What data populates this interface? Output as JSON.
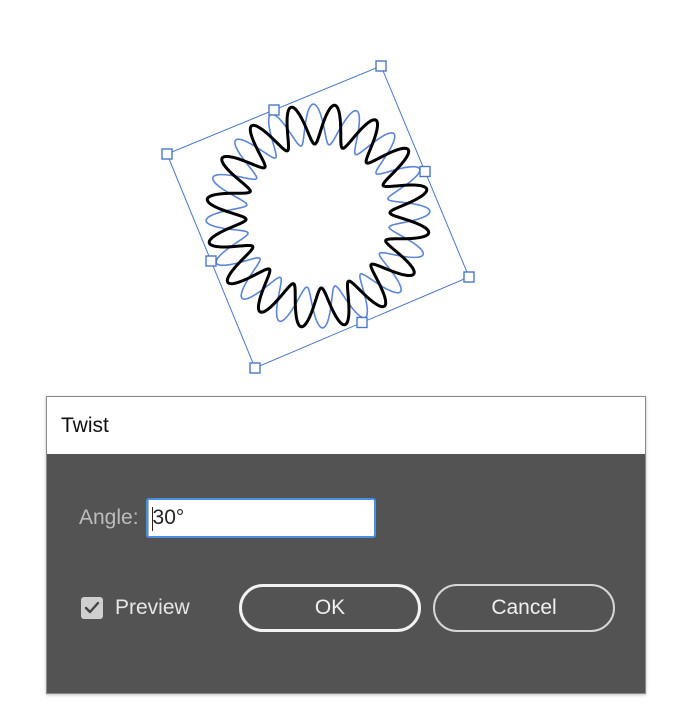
{
  "dialog": {
    "title": "Twist",
    "angle": {
      "label": "Angle:",
      "value": "30°"
    },
    "preview": {
      "label": "Preview",
      "checked": true
    },
    "buttons": {
      "ok": "OK",
      "cancel": "Cancel"
    }
  },
  "colors": {
    "selection": "#4a78c8",
    "original_path": "#5b86d6",
    "twisted_path": "#000000",
    "dialog_body": "#535353",
    "field_focus": "#4a90e2"
  },
  "icons": {
    "stepper_up": "chevron-up-icon",
    "stepper_down": "chevron-down-icon",
    "checkbox": "checkmark-icon"
  }
}
